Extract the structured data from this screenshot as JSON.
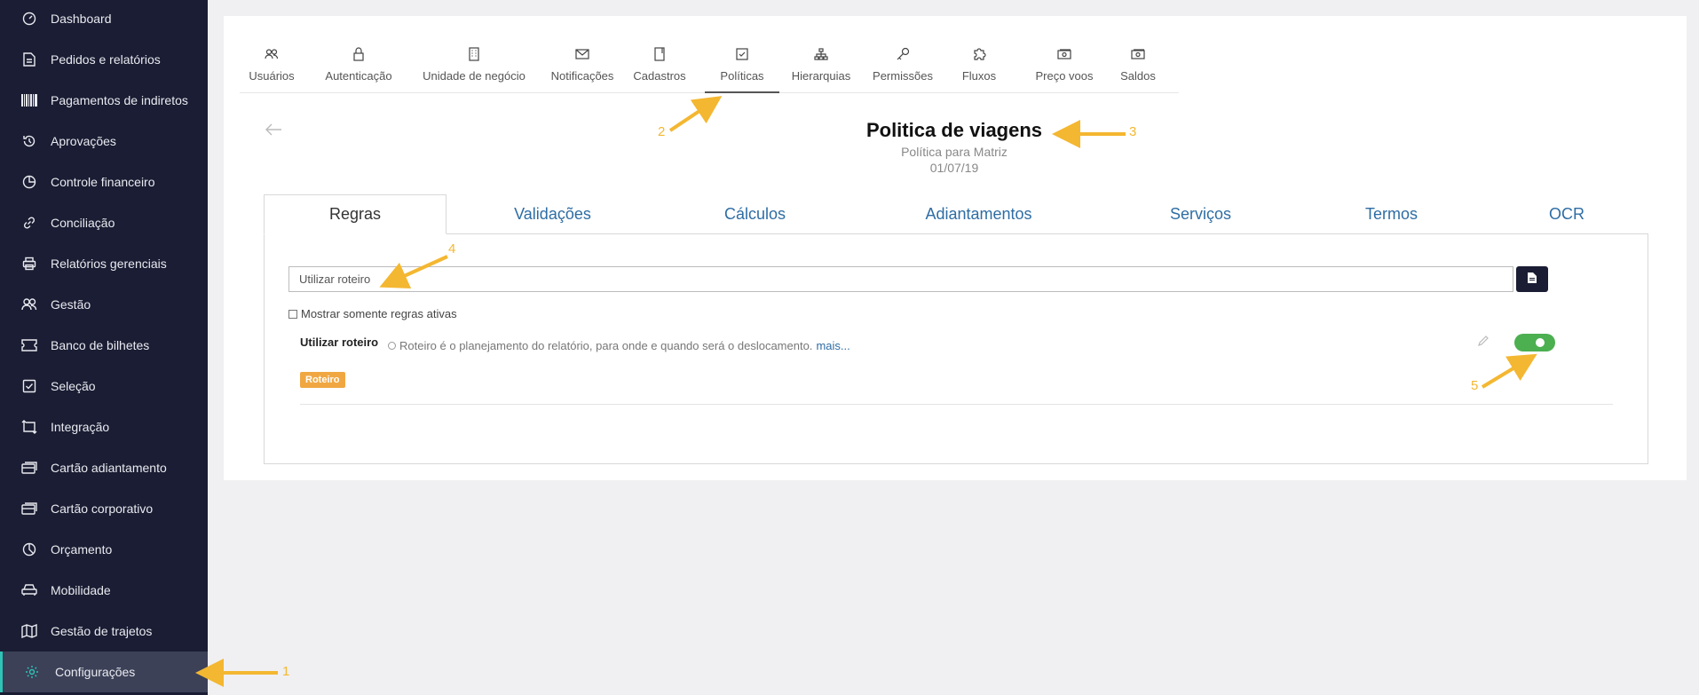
{
  "sidebar": {
    "items": [
      {
        "label": "Dashboard",
        "icon": "gauge-icon"
      },
      {
        "label": "Pedidos e relatórios",
        "icon": "document-icon"
      },
      {
        "label": "Pagamentos de indiretos",
        "icon": "barcode-icon"
      },
      {
        "label": "Aprovações",
        "icon": "history-icon"
      },
      {
        "label": "Controle financeiro",
        "icon": "pie-chart-icon"
      },
      {
        "label": "Conciliação",
        "icon": "link-icon"
      },
      {
        "label": "Relatórios gerenciais",
        "icon": "printer-icon"
      },
      {
        "label": "Gestão",
        "icon": "users-icon"
      },
      {
        "label": "Banco de bilhetes",
        "icon": "ticket-icon"
      },
      {
        "label": "Seleção",
        "icon": "checkbox-icon"
      },
      {
        "label": "Integração",
        "icon": "repeat-icon"
      },
      {
        "label": "Cartão adiantamento",
        "icon": "card-icon"
      },
      {
        "label": "Cartão corporativo",
        "icon": "card-icon"
      },
      {
        "label": "Orçamento",
        "icon": "pie-chart-icon"
      },
      {
        "label": "Mobilidade",
        "icon": "car-icon"
      },
      {
        "label": "Gestão de trajetos",
        "icon": "map-icon"
      },
      {
        "label": "Configurações",
        "icon": "gear-icon",
        "active": true
      }
    ]
  },
  "topnav": {
    "tabs": [
      {
        "label": "Usuários",
        "icon": "users-icon"
      },
      {
        "label": "Autenticação",
        "icon": "lock-icon"
      },
      {
        "label": "Unidade de negócio",
        "icon": "building-icon"
      },
      {
        "label": "Notificações",
        "icon": "envelope-icon"
      },
      {
        "label": "Cadastros",
        "icon": "notebook-icon"
      },
      {
        "label": "Políticas",
        "icon": "check-square-icon",
        "active": true
      },
      {
        "label": "Hierarquias",
        "icon": "sitemap-icon"
      },
      {
        "label": "Permissões",
        "icon": "key-icon"
      },
      {
        "label": "Fluxos",
        "icon": "puzzle-icon"
      },
      {
        "label": "Preço voos",
        "icon": "money-icon"
      },
      {
        "label": "Saldos",
        "icon": "money-icon"
      }
    ]
  },
  "header": {
    "title": "Politica de viagens",
    "subtitle": "Política para Matriz",
    "date": "01/07/19"
  },
  "subtabs": [
    "Regras",
    "Validações",
    "Cálculos",
    "Adiantamentos",
    "Serviços",
    "Termos",
    "OCR"
  ],
  "rules": {
    "search_value": "Utilizar roteiro",
    "show_active_label": "Mostrar somente regras ativas",
    "item": {
      "name": "Utilizar roteiro",
      "description": "Roteiro é o planejamento do relatório, para onde e quando será o deslocamento.",
      "more": "mais...",
      "tag": "Roteiro",
      "enabled": true
    }
  },
  "annotations": [
    "1",
    "2",
    "3",
    "4",
    "5"
  ],
  "colors": {
    "sidebar_bg": "#1a1d33",
    "accent": "#2ec4b6",
    "link": "#2e6da4",
    "toggle_on": "#4caf50",
    "tag": "#f0a742",
    "annotation": "#f4b731"
  }
}
